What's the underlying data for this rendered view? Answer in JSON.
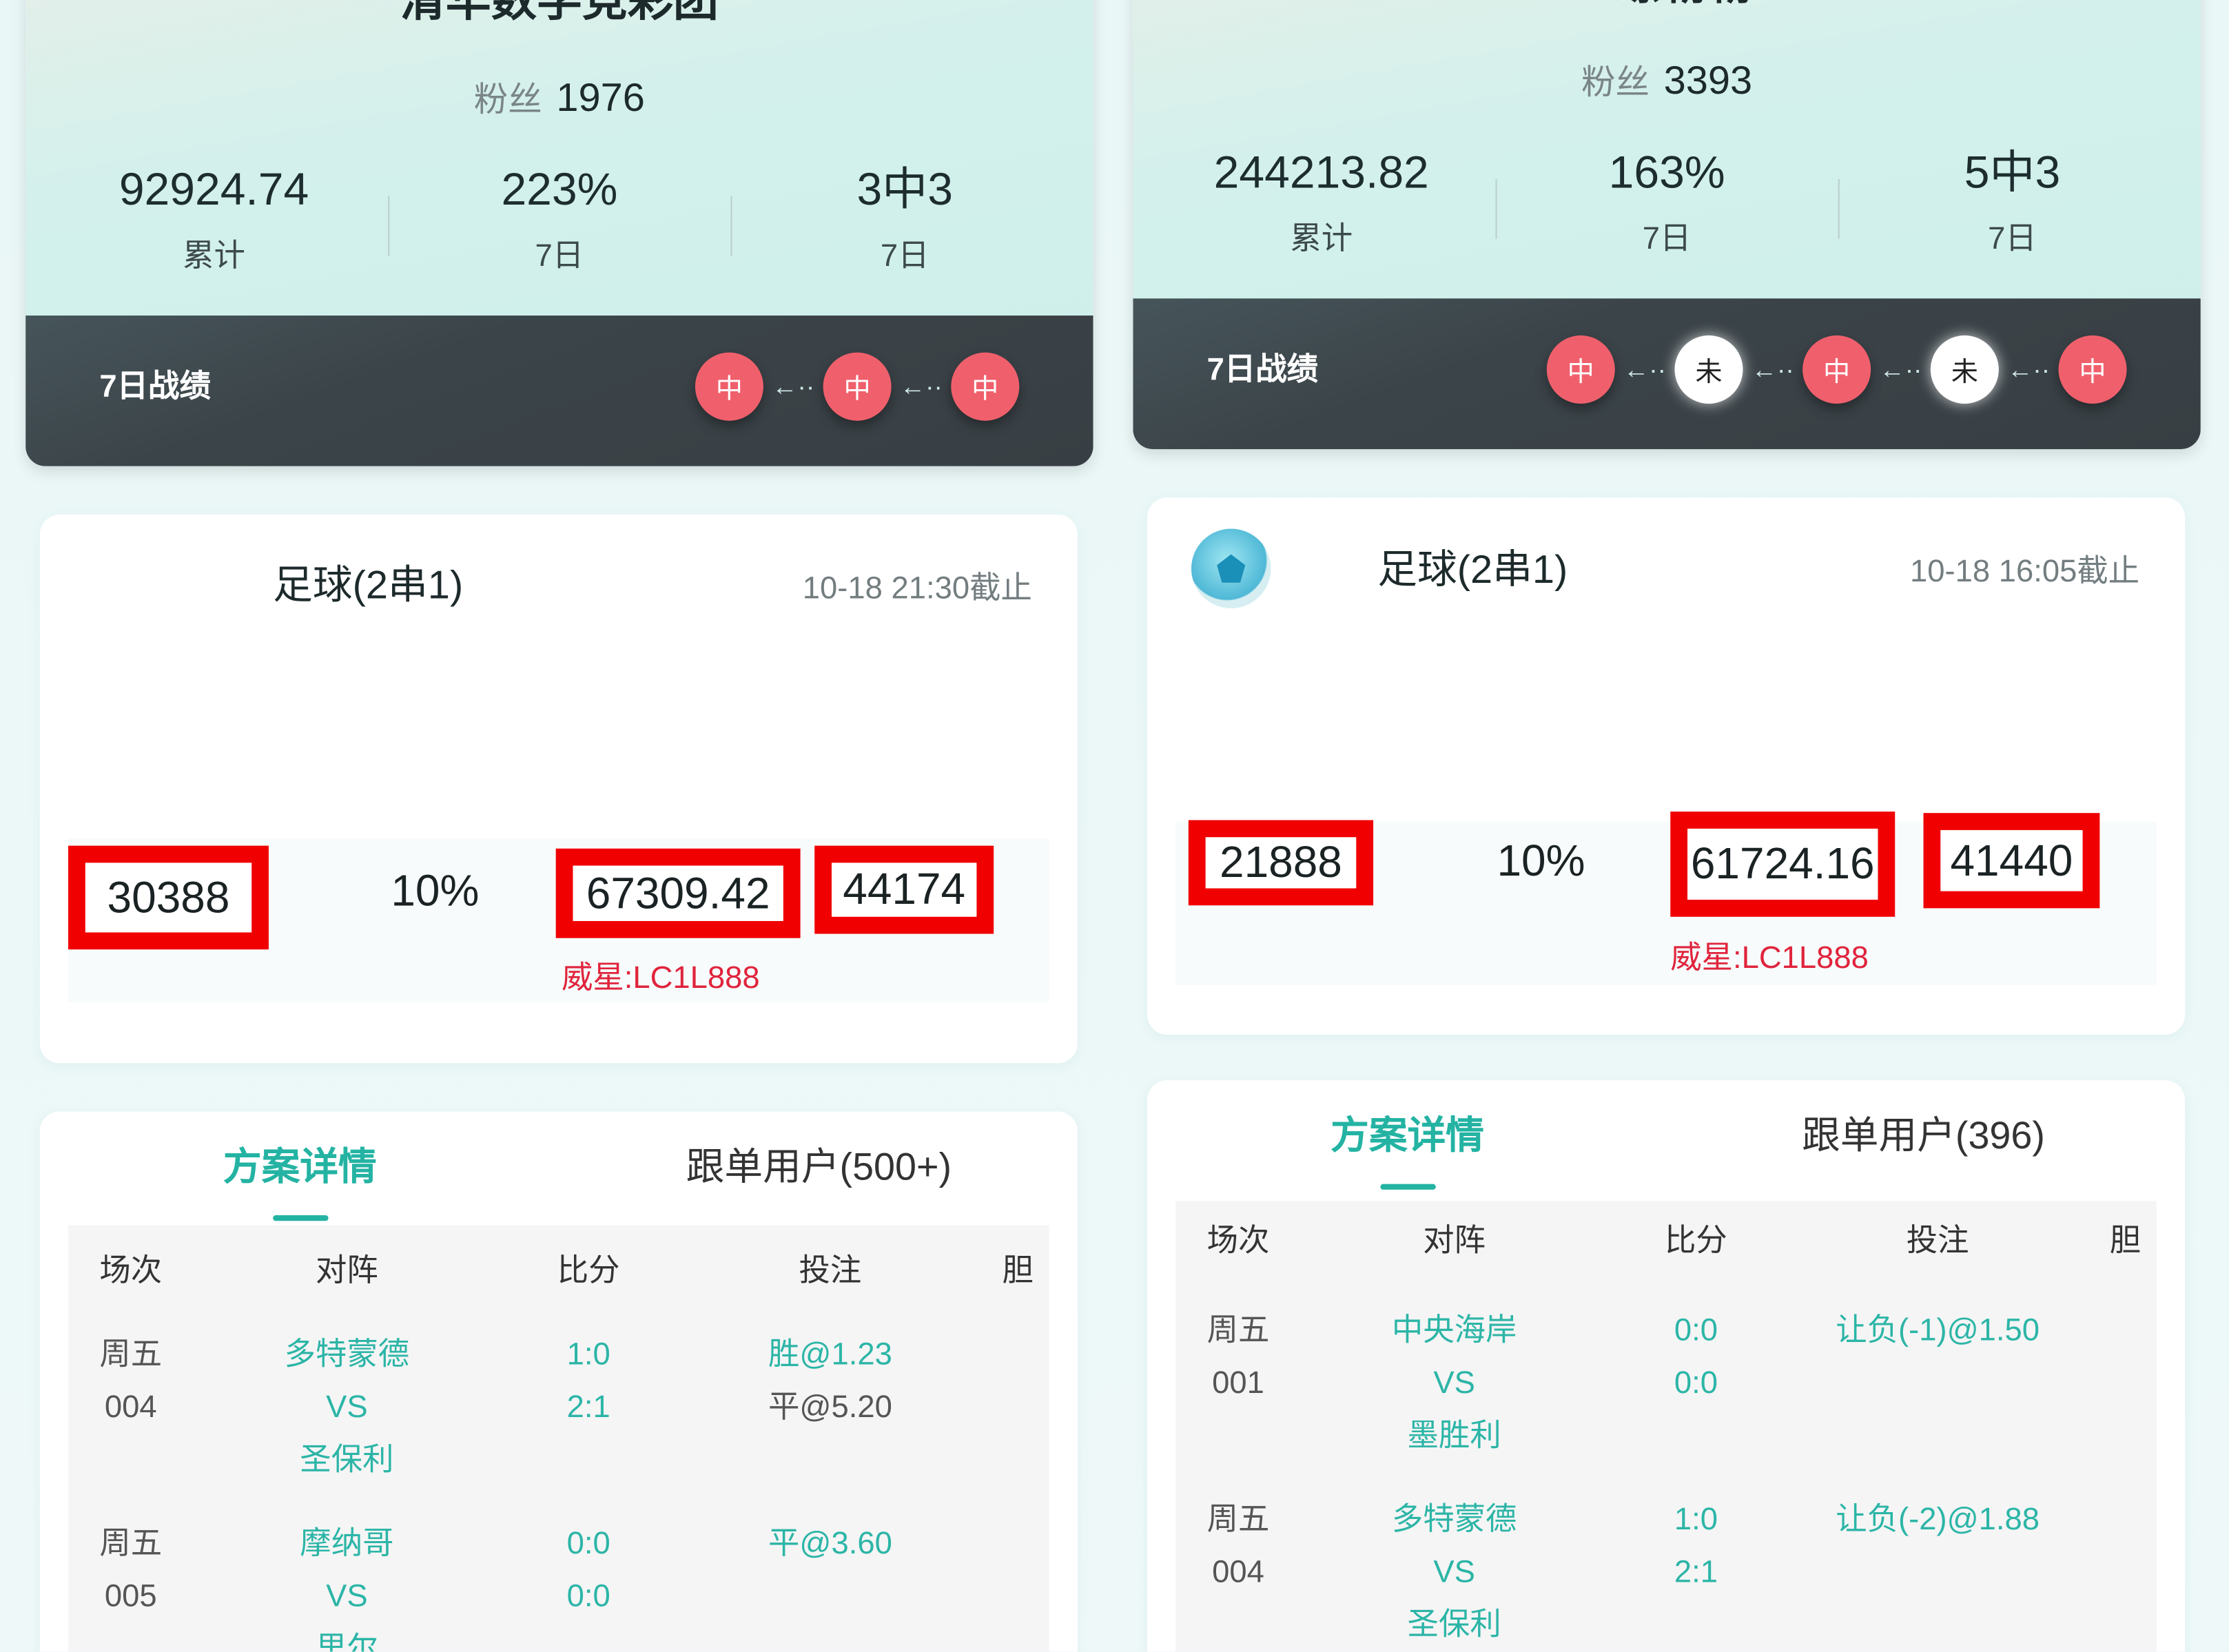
{
  "colors": {
    "accent": "#24b3a3",
    "hit": "#f0606c",
    "miss": "#ffffff",
    "highlight_box": "#f00000",
    "promo": "#e0243c"
  },
  "panels": [
    {
      "name": "清华数学竞彩团",
      "fans_label": "粉丝",
      "fans": "1976",
      "stats": [
        {
          "value": "92924.74",
          "label": "累计"
        },
        {
          "value": "223%",
          "label": "7日"
        },
        {
          "value": "3中3",
          "label": "7日"
        }
      ],
      "record_label": "7日战绩",
      "record_arrow": "←··",
      "record": [
        {
          "text": "中",
          "status": "hit"
        },
        {
          "text": "中",
          "status": "hit"
        },
        {
          "text": "中",
          "status": "hit"
        }
      ],
      "plan": {
        "icon": "football-icon",
        "title": "足球(2串1)",
        "deadline": "10-18 21:30截止",
        "stats": [
          "30388",
          "10%",
          "67309.42",
          "44174"
        ],
        "promo": "威星:LC1L888"
      },
      "tabs": [
        "方案详情",
        "跟单用户(500+)"
      ],
      "table": {
        "headers": [
          "场次",
          "对阵",
          "比分",
          "投注",
          "胆"
        ],
        "rows": [
          {
            "day": "周五",
            "num": "004",
            "home": "多特蒙德",
            "vs": "VS",
            "away": "圣保利",
            "scores": [
              "1:0",
              "2:1"
            ],
            "bets": [
              {
                "text": "胜@1.23",
                "hit": true
              },
              {
                "text": "平@5.20",
                "hit": false
              }
            ]
          },
          {
            "day": "周五",
            "num": "005",
            "home": "摩纳哥",
            "vs": "VS",
            "away": "里尔",
            "scores": [
              "0:0",
              "0:0"
            ],
            "bets": [
              {
                "text": "平@3.60",
                "hit": true
              }
            ]
          }
        ]
      }
    },
    {
      "name": "C螺霸霸",
      "fans_label": "粉丝",
      "fans": "3393",
      "stats": [
        {
          "value": "244213.82",
          "label": "累计"
        },
        {
          "value": "163%",
          "label": "7日"
        },
        {
          "value": "5中3",
          "label": "7日"
        }
      ],
      "record_label": "7日战绩",
      "record_arrow": "←··",
      "record": [
        {
          "text": "中",
          "status": "hit"
        },
        {
          "text": "未",
          "status": "miss"
        },
        {
          "text": "中",
          "status": "hit"
        },
        {
          "text": "未",
          "status": "miss"
        },
        {
          "text": "中",
          "status": "hit"
        }
      ],
      "plan": {
        "icon": "football-icon",
        "title": "足球(2串1)",
        "deadline": "10-18 16:05截止",
        "stats": [
          "21888",
          "10%",
          "61724.16",
          "41440"
        ],
        "promo": "威星:LC1L888"
      },
      "tabs": [
        "方案详情",
        "跟单用户(396)"
      ],
      "table": {
        "headers": [
          "场次",
          "对阵",
          "比分",
          "投注",
          "胆"
        ],
        "rows": [
          {
            "day": "周五",
            "num": "001",
            "home": "中央海岸",
            "vs": "VS",
            "away": "墨胜利",
            "scores": [
              "0:0",
              "0:0"
            ],
            "bets": [
              {
                "text": "让负(-1)@1.50",
                "hit": true
              }
            ]
          },
          {
            "day": "周五",
            "num": "004",
            "home": "多特蒙德",
            "vs": "VS",
            "away": "圣保利",
            "scores": [
              "1:0",
              "2:1"
            ],
            "bets": [
              {
                "text": "让负(-2)@1.88",
                "hit": true
              }
            ]
          }
        ]
      }
    }
  ]
}
